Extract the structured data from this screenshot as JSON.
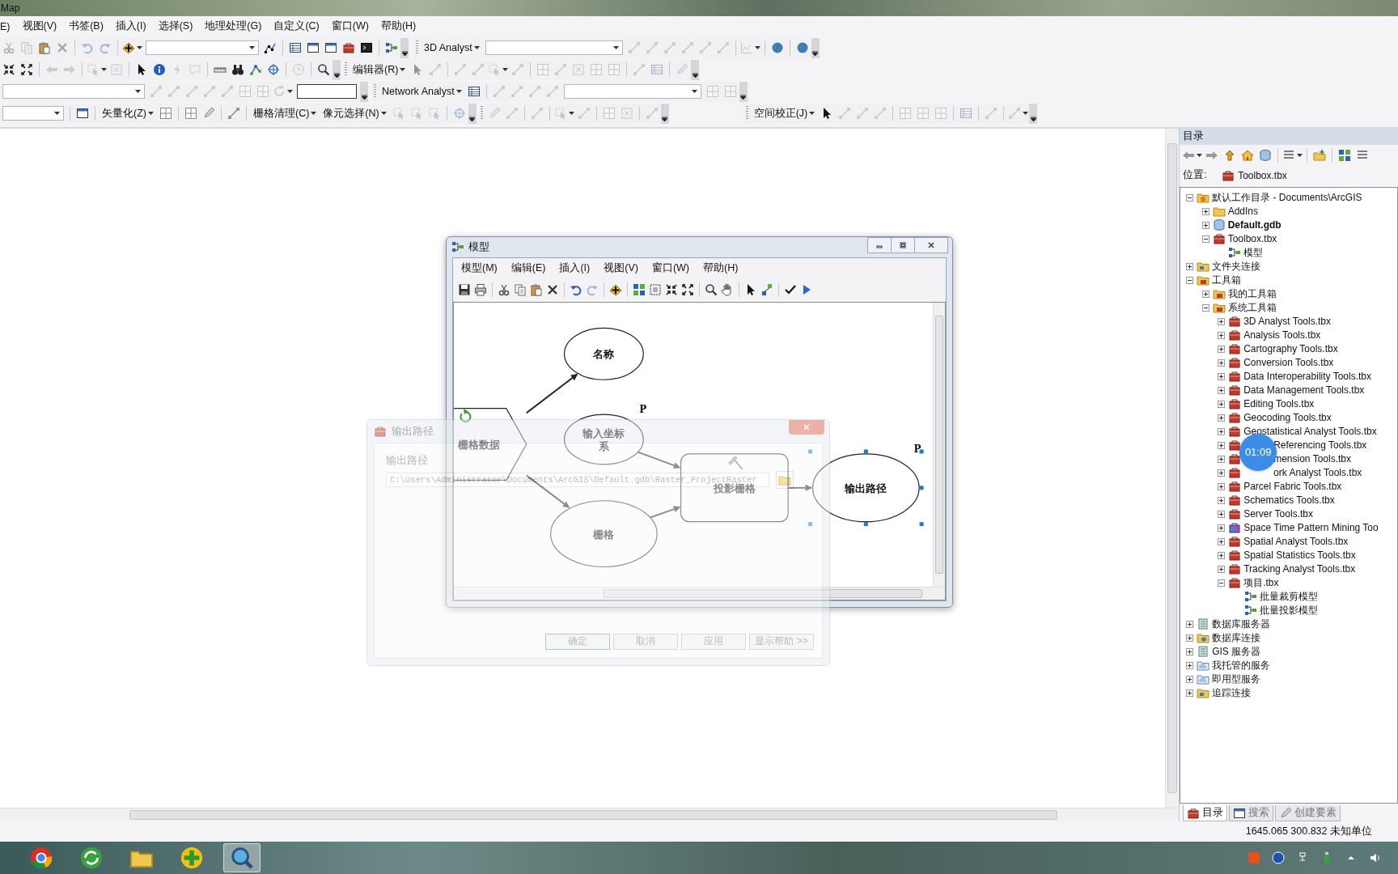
{
  "window": {
    "title": "Map"
  },
  "menu": [
    "E)",
    "视图(V)",
    "书签(B)",
    "插入(I)",
    "选择(S)",
    "地理处理(G)",
    "自定义(C)",
    "窗口(W)",
    "帮助(H)"
  ],
  "toolbars": [
    {
      "bands": [
        {
          "items": [
            {
              "kind": "tool",
              "disabled": true
            },
            {
              "kind": "tool",
              "disabled": true
            },
            {
              "kind": "tool",
              "disabled": false
            },
            {
              "kind": "tool",
              "disabled": true
            },
            {
              "kind": "sep"
            },
            {
              "kind": "tool",
              "disabled": true
            },
            {
              "kind": "tool",
              "disabled": true
            },
            {
              "kind": "sep"
            },
            {
              "kind": "menutool",
              "disabled": false
            },
            {
              "kind": "combo"
            },
            {
              "kind": "tool",
              "disabled": false
            },
            {
              "kind": "sep"
            },
            {
              "kind": "tool",
              "disabled": false
            },
            {
              "kind": "tool",
              "disabled": false
            },
            {
              "kind": "tool",
              "disabled": false
            },
            {
              "kind": "tool",
              "disabled": false
            },
            {
              "kind": "tool",
              "disabled": false
            },
            {
              "kind": "sep"
            },
            {
              "kind": "tool",
              "disabled": false
            },
            {
              "kind": "end"
            }
          ]
        },
        {
          "items": [
            {
              "kind": "grip"
            },
            {
              "kind": "dropdown",
              "label": "3D Analyst"
            },
            {
              "kind": "combo"
            },
            {
              "kind": "tool",
              "disabled": true
            },
            {
              "kind": "tool",
              "disabled": true
            },
            {
              "kind": "tool",
              "disabled": true
            },
            {
              "kind": "tool",
              "disabled": true
            },
            {
              "kind": "tool",
              "disabled": true
            },
            {
              "kind": "tool",
              "disabled": true
            },
            {
              "kind": "sep"
            },
            {
              "kind": "menutool",
              "disabled": true
            },
            {
              "kind": "sep"
            },
            {
              "kind": "tool",
              "disabled": false
            },
            {
              "kind": "sep"
            },
            {
              "kind": "tool",
              "disabled": false
            },
            {
              "kind": "end"
            }
          ]
        }
      ]
    },
    {
      "bands": [
        {
          "items": [
            {
              "kind": "tool",
              "disabled": false
            },
            {
              "kind": "tool",
              "disabled": false
            },
            {
              "kind": "sep"
            },
            {
              "kind": "tool",
              "disabled": true
            },
            {
              "kind": "tool",
              "disabled": true
            },
            {
              "kind": "sep"
            },
            {
              "kind": "menutool",
              "disabled": true
            },
            {
              "kind": "tool",
              "disabled": true
            },
            {
              "kind": "sep"
            },
            {
              "kind": "tool",
              "disabled": false
            },
            {
              "kind": "tool",
              "disabled": false
            },
            {
              "kind": "tool",
              "disabled": true
            },
            {
              "kind": "tool",
              "disabled": true
            },
            {
              "kind": "sep"
            },
            {
              "kind": "tool",
              "disabled": false
            },
            {
              "kind": "tool",
              "disabled": false
            },
            {
              "kind": "tool",
              "disabled": false
            },
            {
              "kind": "tool",
              "disabled": false
            },
            {
              "kind": "sep"
            },
            {
              "kind": "tool",
              "disabled": true
            },
            {
              "kind": "sep"
            },
            {
              "kind": "tool",
              "disabled": false
            },
            {
              "kind": "end"
            }
          ]
        },
        {
          "items": [
            {
              "kind": "grip"
            },
            {
              "kind": "dropdown",
              "label": "编辑器(R)"
            },
            {
              "kind": "tool",
              "disabled": true
            },
            {
              "kind": "tool",
              "disabled": true
            },
            {
              "kind": "sep"
            },
            {
              "kind": "tool",
              "disabled": true
            },
            {
              "kind": "tool",
              "disabled": true
            },
            {
              "kind": "menutool",
              "disabled": true
            },
            {
              "kind": "tool",
              "disabled": true
            },
            {
              "kind": "sep"
            },
            {
              "kind": "tool",
              "disabled": true
            },
            {
              "kind": "tool",
              "disabled": true
            },
            {
              "kind": "tool",
              "disabled": true
            },
            {
              "kind": "tool",
              "disabled": true
            },
            {
              "kind": "tool",
              "disabled": true
            },
            {
              "kind": "sep"
            },
            {
              "kind": "tool",
              "disabled": true
            },
            {
              "kind": "tool",
              "disabled": true
            },
            {
              "kind": "sep"
            },
            {
              "kind": "tool",
              "disabled": true
            },
            {
              "kind": "end"
            }
          ]
        }
      ]
    },
    {
      "bands": [
        {
          "items": [
            {
              "kind": "combo"
            },
            {
              "kind": "tool",
              "disabled": true
            },
            {
              "kind": "tool",
              "disabled": true
            },
            {
              "kind": "tool",
              "disabled": true
            },
            {
              "kind": "tool",
              "disabled": true
            },
            {
              "kind": "tool",
              "disabled": true
            },
            {
              "kind": "tool",
              "disabled": true
            },
            {
              "kind": "tool",
              "disabled": true
            },
            {
              "kind": "menutool",
              "disabled": true
            },
            {
              "kind": "field"
            },
            {
              "kind": "end"
            }
          ]
        },
        {
          "items": [
            {
              "kind": "grip"
            },
            {
              "kind": "dropdown",
              "label": "Network Analyst"
            },
            {
              "kind": "tool",
              "disabled": false
            },
            {
              "kind": "sep"
            },
            {
              "kind": "tool",
              "disabled": true
            },
            {
              "kind": "tool",
              "disabled": true
            },
            {
              "kind": "tool",
              "disabled": true
            },
            {
              "kind": "tool",
              "disabled": true
            },
            {
              "kind": "combo"
            },
            {
              "kind": "tool",
              "disabled": true
            },
            {
              "kind": "tool",
              "disabled": true
            },
            {
              "kind": "end"
            }
          ]
        }
      ]
    },
    {
      "bands": [
        {
          "items": [
            {
              "kind": "combo"
            },
            {
              "kind": "sep"
            },
            {
              "kind": "tool",
              "disabled": false
            },
            {
              "kind": "sep"
            },
            {
              "kind": "dropdown",
              "label": "矢量化(Z)"
            },
            {
              "kind": "tool",
              "disabled": false
            },
            {
              "kind": "sep"
            },
            {
              "kind": "tool",
              "disabled": false
            },
            {
              "kind": "tool",
              "disabled": false
            },
            {
              "kind": "sep"
            },
            {
              "kind": "tool",
              "disabled": false
            },
            {
              "kind": "sep"
            },
            {
              "kind": "dropdown",
              "label": "栅格清理(C)"
            },
            {
              "kind": "dropdown",
              "label": "像元选择(N)"
            },
            {
              "kind": "tool",
              "disabled": true
            },
            {
              "kind": "tool",
              "disabled": true
            },
            {
              "kind": "tool",
              "disabled": true
            },
            {
              "kind": "sep"
            },
            {
              "kind": "tool",
              "disabled": true
            },
            {
              "kind": "end"
            }
          ]
        },
        {
          "items": [
            {
              "kind": "grip"
            },
            {
              "kind": "tool",
              "disabled": true
            },
            {
              "kind": "tool",
              "disabled": true
            },
            {
              "kind": "sep"
            },
            {
              "kind": "tool",
              "disabled": true
            },
            {
              "kind": "sep"
            },
            {
              "kind": "menutool",
              "disabled": true
            },
            {
              "kind": "tool",
              "disabled": true
            },
            {
              "kind": "sep"
            },
            {
              "kind": "tool",
              "disabled": true
            },
            {
              "kind": "tool",
              "disabled": true
            },
            {
              "kind": "sep"
            },
            {
              "kind": "tool",
              "disabled": true
            },
            {
              "kind": "end"
            }
          ]
        },
        {
          "items": [
            {
              "kind": "grip"
            },
            {
              "kind": "dropdown",
              "label": "空间校正(J)"
            },
            {
              "kind": "tool",
              "disabled": false
            },
            {
              "kind": "tool",
              "disabled": true
            },
            {
              "kind": "tool",
              "disabled": true
            },
            {
              "kind": "tool",
              "disabled": true
            },
            {
              "kind": "sep"
            },
            {
              "kind": "tool",
              "disabled": true
            },
            {
              "kind": "tool",
              "disabled": true
            },
            {
              "kind": "tool",
              "disabled": true
            },
            {
              "kind": "sep"
            },
            {
              "kind": "tool",
              "disabled": true
            },
            {
              "kind": "sep"
            },
            {
              "kind": "tool",
              "disabled": true
            },
            {
              "kind": "sep"
            },
            {
              "kind": "menutool",
              "disabled": true
            },
            {
              "kind": "end"
            }
          ]
        }
      ]
    }
  ],
  "model_window": {
    "title": "模型",
    "menu": [
      "模型(M)",
      "编辑(E)",
      "插入(I)",
      "视图(V)",
      "窗口(W)",
      "帮助(H)"
    ],
    "toolbar": [
      {
        "kind": "tool",
        "disabled": false
      },
      {
        "kind": "tool",
        "disabled": false
      },
      {
        "kind": "sep"
      },
      {
        "kind": "tool",
        "disabled": false
      },
      {
        "kind": "tool",
        "disabled": false
      },
      {
        "kind": "tool",
        "disabled": false
      },
      {
        "kind": "tool",
        "disabled": false
      },
      {
        "kind": "sep"
      },
      {
        "kind": "tool",
        "disabled": false
      },
      {
        "kind": "tool",
        "disabled": true
      },
      {
        "kind": "sep"
      },
      {
        "kind": "tool",
        "disabled": false
      },
      {
        "kind": "sep"
      },
      {
        "kind": "tool",
        "disabled": false
      },
      {
        "kind": "tool",
        "disabled": false
      },
      {
        "kind": "tool",
        "disabled": false
      },
      {
        "kind": "tool",
        "disabled": false
      },
      {
        "kind": "sep"
      },
      {
        "kind": "tool",
        "disabled": false
      },
      {
        "kind": "tool",
        "disabled": false
      },
      {
        "kind": "sep"
      },
      {
        "kind": "tool",
        "disabled": false
      },
      {
        "kind": "tool",
        "disabled": false
      },
      {
        "kind": "sep"
      },
      {
        "kind": "tool",
        "disabled": false
      },
      {
        "kind": "tool",
        "disabled": false
      }
    ],
    "nodes": [
      {
        "label": "栅格数据",
        "kind": "iterator",
        "selected": false
      },
      {
        "label": "名称",
        "kind": "variable",
        "selected": false
      },
      {
        "label": "输入坐标系",
        "kind": "variable",
        "parameter_mark": "P",
        "selected": false
      },
      {
        "label": "栅格",
        "kind": "variable",
        "selected": false
      },
      {
        "label": "投影栅格",
        "kind": "tool",
        "selected": false
      },
      {
        "label": "输出路径",
        "kind": "variable",
        "parameter_mark": "P",
        "selected": true
      }
    ]
  },
  "output_dialog": {
    "title": "输出路径",
    "label": "输出路径",
    "path": "C:\\Users\\Administrator\\Documents\\ArcGIS\\Default.gdb\\Raster_ProjectRaster",
    "buttons": [
      {
        "label": "确定",
        "default": true
      },
      {
        "label": "取消",
        "default": false
      },
      {
        "label": "应用",
        "default": false
      },
      {
        "label": "显示帮助 >>",
        "default": false
      }
    ]
  },
  "catalog": {
    "title": "目录",
    "location_label": "位置:",
    "location": "Toolbox.tbx",
    "tree": [
      {
        "label": "默认工作目录 - Documents\\ArcGIS",
        "kind": "home-folder",
        "expanded": true,
        "children": [
          {
            "label": "AddIns",
            "kind": "folder",
            "expanded": false,
            "default": false
          },
          {
            "label": "Default.gdb",
            "kind": "gdb",
            "expanded": false,
            "default": true
          },
          {
            "label": "Toolbox.tbx",
            "kind": "toolbox",
            "expanded": true,
            "default": false,
            "children": [
              {
                "label": "模型",
                "kind": "model"
              }
            ]
          }
        ]
      },
      {
        "label": "文件夹连接",
        "kind": "link-folder",
        "expanded": false
      },
      {
        "label": "工具箱",
        "kind": "toolbox-folder",
        "expanded": true,
        "children": [
          {
            "label": "我的工具箱",
            "kind": "toolbox-folder",
            "expanded": false
          },
          {
            "label": "系统工具箱",
            "kind": "toolbox-folder",
            "expanded": true,
            "children": [
              {
                "label": "3D Analyst Tools.tbx",
                "kind": "toolbox",
                "expanded": false,
                "obscured": false
              },
              {
                "label": "Analysis Tools.tbx",
                "kind": "toolbox",
                "expanded": false,
                "obscured": false
              },
              {
                "label": "Cartography Tools.tbx",
                "kind": "toolbox",
                "expanded": false,
                "obscured": false
              },
              {
                "label": "Conversion Tools.tbx",
                "kind": "toolbox",
                "expanded": false,
                "obscured": false
              },
              {
                "label": "Data Interoperability Tools.tbx",
                "kind": "toolbox",
                "expanded": false,
                "obscured": false
              },
              {
                "label": "Data Management Tools.tbx",
                "kind": "toolbox",
                "expanded": false,
                "obscured": false
              },
              {
                "label": "Editing Tools.tbx",
                "kind": "toolbox",
                "expanded": false,
                "obscured": false
              },
              {
                "label": "Geocoding Tools.tbx",
                "kind": "toolbox",
                "expanded": false,
                "obscured": false
              },
              {
                "label": "Geostatistical Analyst Tools.tbx",
                "kind": "toolbox",
                "expanded": false,
                "obscured": false
              },
              {
                "label": "Referencing Tools.tbx",
                "kind": "toolbox",
                "expanded": false,
                "obscured": true
              },
              {
                "label": "mension Tools.tbx",
                "kind": "toolbox",
                "expanded": false,
                "obscured": true
              },
              {
                "label": "ork Analyst Tools.tbx",
                "kind": "toolbox",
                "expanded": false,
                "obscured": true
              },
              {
                "label": "Parcel Fabric Tools.tbx",
                "kind": "toolbox",
                "expanded": false,
                "obscured": false
              },
              {
                "label": "Schematics Tools.tbx",
                "kind": "toolbox",
                "expanded": false,
                "obscured": false
              },
              {
                "label": "Server Tools.tbx",
                "kind": "toolbox",
                "expanded": false,
                "obscured": false
              },
              {
                "label": "Space Time Pattern Mining Too",
                "kind": "script-toolbox",
                "expanded": false,
                "obscured": false
              },
              {
                "label": "Spatial Analyst Tools.tbx",
                "kind": "toolbox",
                "expanded": false,
                "obscured": false
              },
              {
                "label": "Spatial Statistics Tools.tbx",
                "kind": "toolbox",
                "expanded": false,
                "obscured": false
              },
              {
                "label": "Tracking Analyst Tools.tbx",
                "kind": "toolbox",
                "expanded": false,
                "obscured": false
              },
              {
                "label": "项目.tbx",
                "kind": "toolbox",
                "expanded": true,
                "obscured": false,
                "children": [
                  {
                    "label": "批量裁剪模型",
                    "kind": "model"
                  },
                  {
                    "label": "批量投影模型",
                    "kind": "model"
                  }
                ]
              }
            ]
          }
        ]
      },
      {
        "label": "数据库服务器",
        "kind": "server",
        "expanded": false
      },
      {
        "label": "数据库连接",
        "kind": "db-connection",
        "expanded": false
      },
      {
        "label": "GIS 服务器",
        "kind": "server",
        "expanded": false
      },
      {
        "label": "我托管的服务",
        "kind": "cloud-folder",
        "expanded": false
      },
      {
        "label": "即用型服务",
        "kind": "cloud-folder",
        "expanded": false
      },
      {
        "label": "追踪连接",
        "kind": "link-folder",
        "expanded": false
      }
    ],
    "timer_badge": "01:09",
    "tabs": [
      {
        "label": "目录",
        "selected": true
      },
      {
        "label": "搜索",
        "selected": false
      },
      {
        "label": "创建要素",
        "selected": false
      }
    ]
  },
  "status_bar": {
    "coordinates": "1645.065 300.832 未知单位"
  },
  "taskbar": {
    "apps": [
      {
        "active": false
      },
      {
        "active": false
      },
      {
        "active": false
      },
      {
        "active": false
      },
      {
        "active": true
      }
    ]
  }
}
